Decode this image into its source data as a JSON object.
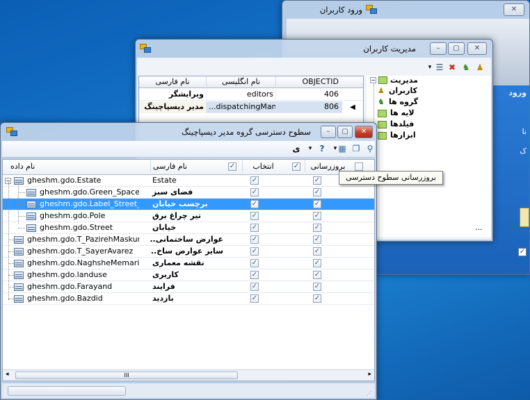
{
  "login_window": {
    "title": "ورود کاربران",
    "side_title_fragment": "ورود",
    "side_text_1": "نا",
    "side_text_2": "ک"
  },
  "users_window": {
    "title": "مدیریت کاربران",
    "grid": {
      "headers": [
        "OBJECTID",
        "نام انگلیسی",
        "نام فارسی"
      ],
      "rows": [
        {
          "objectid": "406",
          "en": "editors",
          "fa": "ویرایشگر"
        },
        {
          "objectid": "806",
          "en": "...dispatchingMana",
          "fa": "مدیر دیسپاچینگ"
        }
      ]
    },
    "tree": {
      "root": "مدیریت",
      "children": [
        "کاربران",
        "گروه ها",
        "لایه ها",
        "فیلدها",
        "ابزارها"
      ]
    },
    "footer_ellipsis": "..."
  },
  "access_window": {
    "title": "سطوح دسترسی گروه مدیر دیسپاچینگ",
    "toolbar_char": "ی",
    "tooltip": "بروزرسانی سطوح دسترسی",
    "headers": {
      "update": "بروزرسانی",
      "select": "انتخاب",
      "farsi_name": "نام فارسی",
      "data_name": "نام داده"
    },
    "rows": [
      {
        "data": "gheshm.gdo.Estate",
        "fa": "Estate",
        "update": true,
        "select": true
      },
      {
        "data": "gheshm.gdo.Green_Space",
        "fa": "فضای سبز",
        "update": true,
        "select": true
      },
      {
        "data": "gheshm.gdo.Label_Street_Pl...",
        "fa": "برچسب خیابان",
        "update": true,
        "select": true
      },
      {
        "data": "gheshm.gdo.Pole",
        "fa": "تیر چراغ برق",
        "update": true,
        "select": true
      },
      {
        "data": "gheshm.gdo.Street",
        "fa": "خیابان",
        "update": true,
        "select": true
      },
      {
        "data": "gheshm.gdo.T_PazirehMaskuni",
        "fa": "عوارض ساختمانی...",
        "update": true,
        "select": true
      },
      {
        "data": "gheshm.gdo.T_SayerAvarez",
        "fa": "سایر عوارض ساخ...",
        "update": true,
        "select": true
      },
      {
        "data": "gheshm.gdo.NaghsheMemari",
        "fa": "نقشه معماری",
        "update": true,
        "select": true
      },
      {
        "data": "gheshm.gdo.landuse",
        "fa": "کاربری",
        "update": true,
        "select": true
      },
      {
        "data": "gheshm.gdo.Farayand",
        "fa": "فرایند",
        "update": true,
        "select": true
      },
      {
        "data": "gheshm.gdo.Bazdid",
        "fa": "بازدید",
        "update": true,
        "select": true
      }
    ],
    "hscroll_grip": "III"
  },
  "colors": {
    "selection": "#3399ff",
    "highlight": "#ffea3c",
    "desktop": "#1673c9",
    "close": "#c4402a"
  }
}
